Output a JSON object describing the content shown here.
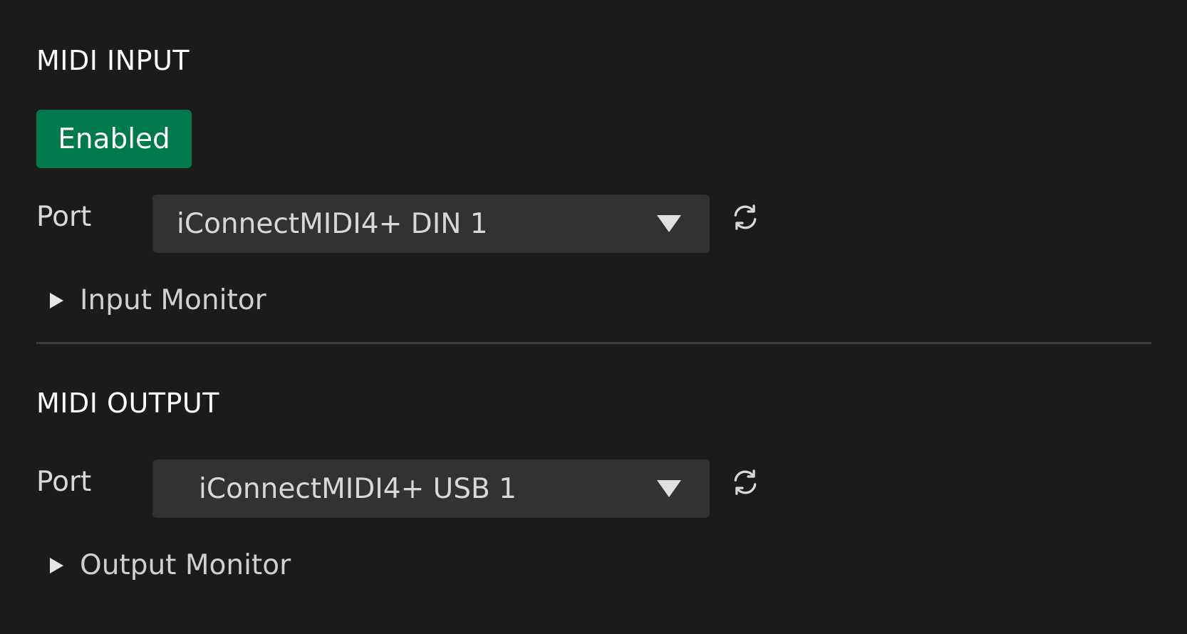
{
  "midi_input": {
    "title": "MIDI INPUT",
    "enabled_label": "Enabled",
    "port_label": "Port",
    "port_value": "iConnectMIDI4+ DIN 1",
    "monitor_label": "Input Monitor"
  },
  "midi_output": {
    "title": "MIDI OUTPUT",
    "port_label": "Port",
    "port_value": "iConnectMIDI4+ USB 1",
    "monitor_label": "Output Monitor"
  },
  "icons": {
    "refresh": "refresh-icon",
    "dropdown": "caret-down-icon",
    "disclosure": "triangle-right-icon"
  },
  "colors": {
    "background": "#1b1b1b",
    "enabled_button": "#007a4d",
    "select_background": "#323232",
    "divider": "#3d3d3d"
  }
}
